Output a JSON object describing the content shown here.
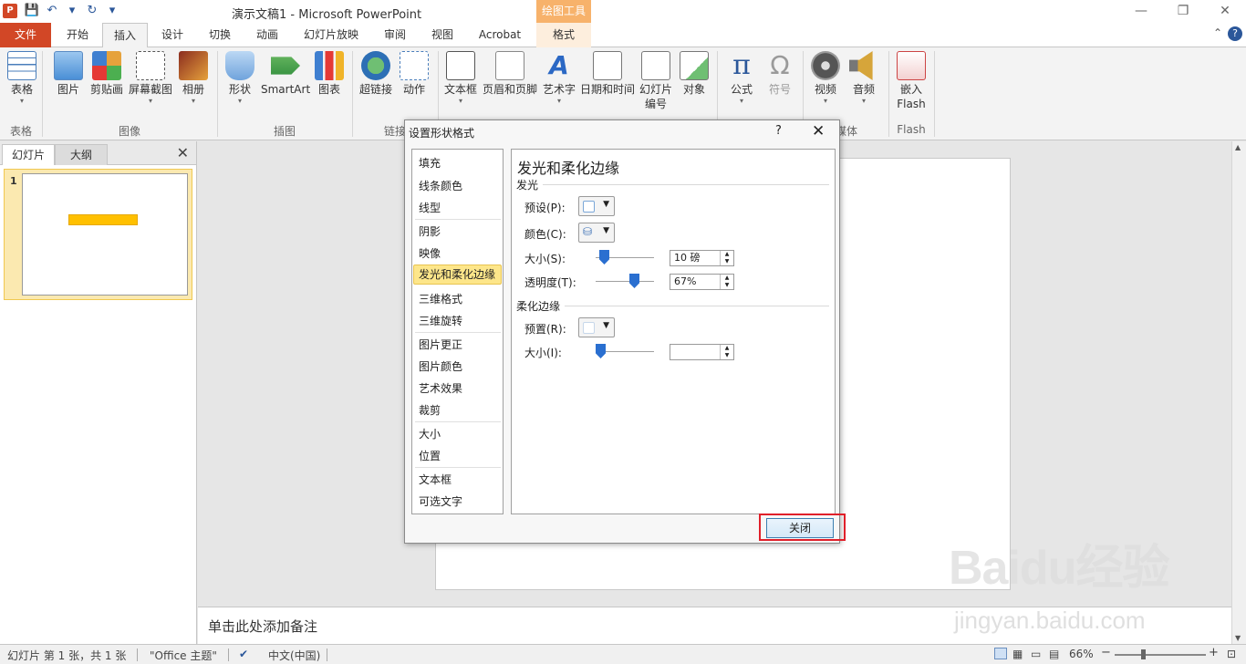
{
  "titlebar": {
    "app_icon_label": "P",
    "title": "演示文稿1 - Microsoft PowerPoint",
    "context_group": "绘图工具",
    "controls": [
      "—",
      "❐",
      "✕"
    ]
  },
  "qat": [
    "💾",
    "↶",
    "▾",
    "↻",
    "▾"
  ],
  "tabs": [
    "文件",
    "开始",
    "插入",
    "设计",
    "切换",
    "动画",
    "幻灯片放映",
    "审阅",
    "视图",
    "Acrobat",
    "格式"
  ],
  "ribbon_right": {
    "collapse": "⌃",
    "help": "?"
  },
  "ribbon": {
    "buttons": [
      {
        "label": "表格",
        "dd": "▾"
      },
      {
        "label": "图片",
        "dd": ""
      },
      {
        "label": "剪贴画",
        "dd": ""
      },
      {
        "label": "屏幕截图",
        "dd": "▾"
      },
      {
        "label": "相册",
        "dd": "▾"
      },
      {
        "label": "形状",
        "dd": "▾"
      },
      {
        "label": "SmartArt",
        "dd": ""
      },
      {
        "label": "图表",
        "dd": ""
      },
      {
        "label": "超链接",
        "dd": ""
      },
      {
        "label": "动作",
        "dd": ""
      },
      {
        "label": "文本框",
        "dd": "▾"
      },
      {
        "label": "页眉和页脚",
        "dd": ""
      },
      {
        "label": "艺术字",
        "dd": "▾"
      },
      {
        "label": "日期和时间",
        "dd": ""
      },
      {
        "label": "幻灯片\n编号",
        "dd": ""
      },
      {
        "label": "对象",
        "dd": ""
      },
      {
        "label": "公式",
        "dd": "▾"
      },
      {
        "label": "符号",
        "dd": ""
      },
      {
        "label": "视频",
        "dd": "▾"
      },
      {
        "label": "音频",
        "dd": "▾"
      },
      {
        "label": "嵌入\nFlash",
        "dd": ""
      }
    ],
    "groups": [
      "表格",
      "图像",
      "插图",
      "链接",
      "媒体",
      "Flash"
    ]
  },
  "left_panel": {
    "tabs": [
      "幻灯片",
      "大纲"
    ],
    "close": "✕",
    "slide_number": "1"
  },
  "notes_placeholder": "单击此处添加备注",
  "statusbar": {
    "slide_info": "幻灯片 第 1 张，共 1 张",
    "theme": "\"Office 主题\"",
    "language": "中文(中国)",
    "zoom": "66%",
    "zoom_minus": "−",
    "zoom_plus": "+"
  },
  "watermark": {
    "brand": "Baidu经验",
    "url": "jingyan.baidu.com"
  },
  "dialog": {
    "title": "设置形状格式",
    "help": "?",
    "close_x": "✕",
    "categories": [
      "填充",
      "线条颜色",
      "线型",
      "阴影",
      "映像",
      "发光和柔化边缘",
      "三维格式",
      "三维旋转",
      "图片更正",
      "图片颜色",
      "艺术效果",
      "裁剪",
      "大小",
      "位置",
      "文本框",
      "可选文字"
    ],
    "active_category": "发光和柔化边缘",
    "pane_title": "发光和柔化边缘",
    "glow": {
      "section": "发光",
      "preset_label": "预设(P):",
      "color_label": "颜色(C):",
      "size_label": "大小(S):",
      "size_value": "10 磅",
      "transparency_label": "透明度(T):",
      "transparency_value": "67%",
      "size_slider_value": 0.1,
      "transparency_slider_value": 0.67
    },
    "soft_edges": {
      "section": "柔化边缘",
      "preset_label": "预置(R):",
      "size_label": "大小(I):",
      "size_value": "",
      "size_slider_value": 0
    },
    "close_button": "关闭"
  }
}
